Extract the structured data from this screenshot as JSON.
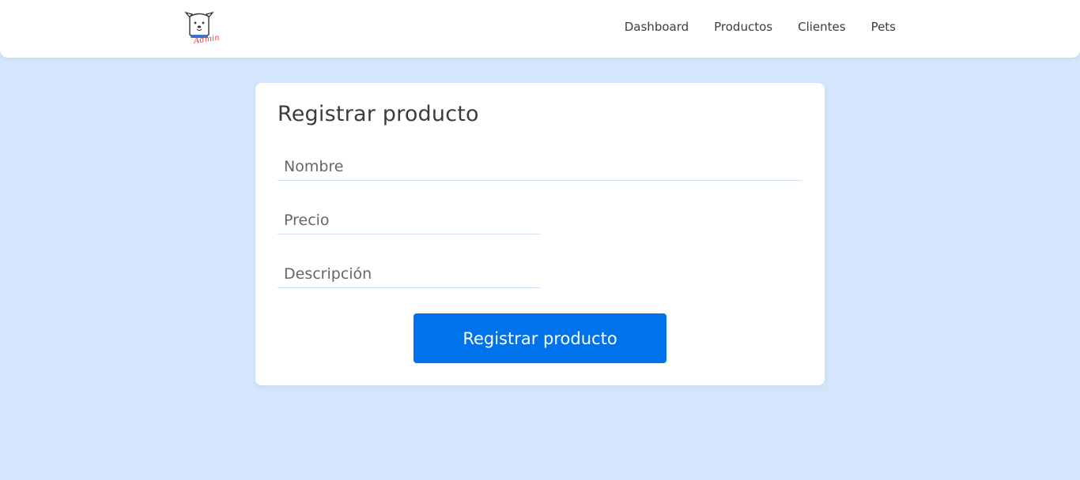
{
  "nav": {
    "logo_text": "Admin",
    "links": [
      "Dashboard",
      "Productos",
      "Clientes",
      "Pets"
    ]
  },
  "form": {
    "title": "Registrar producto",
    "fields": {
      "nombre": {
        "placeholder": "Nombre",
        "value": ""
      },
      "precio": {
        "placeholder": "Precio",
        "value": ""
      },
      "descripcion": {
        "placeholder": "Descripción",
        "value": ""
      }
    },
    "submit_label": "Registrar producto"
  },
  "colors": {
    "page_background": "#d4e6fc",
    "accent": "#0073ea",
    "logo_text": "#e8433c",
    "logo_collar": "#3b6fd4"
  }
}
